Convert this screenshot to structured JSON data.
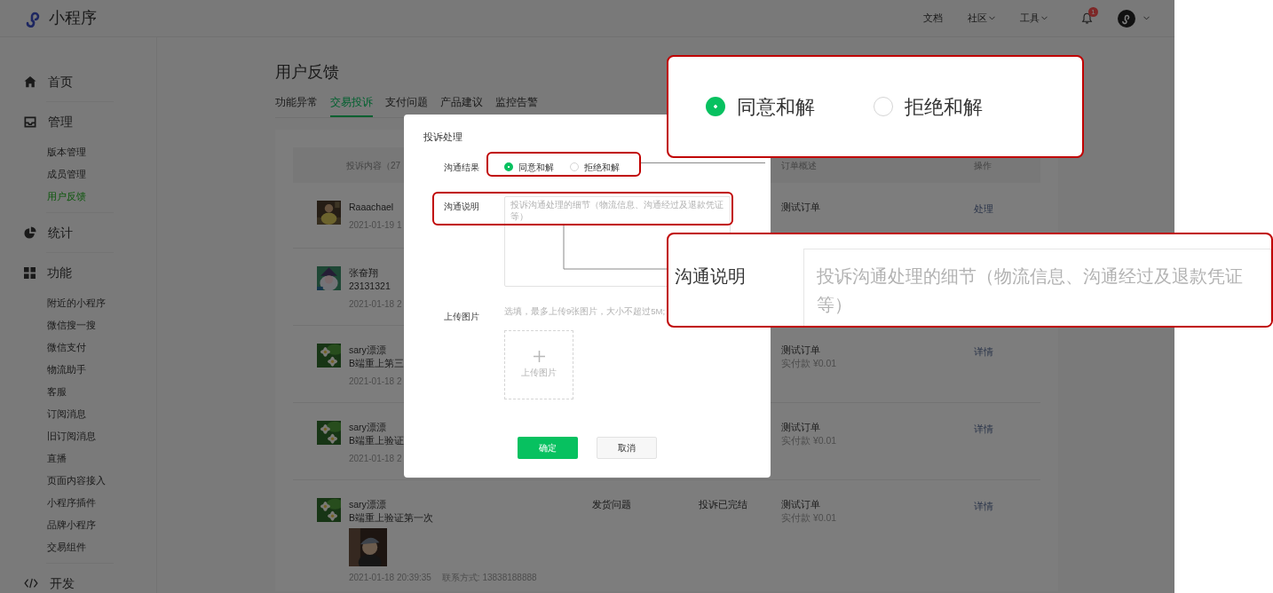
{
  "header": {
    "brand": "小程序",
    "nav": [
      {
        "label": "文档",
        "dropdown": false
      },
      {
        "label": "社区",
        "dropdown": true
      },
      {
        "label": "工具",
        "dropdown": true
      }
    ],
    "notification_count": "1"
  },
  "sidebar": [
    {
      "label": "首页"
    },
    {
      "label": "管理",
      "items": [
        {
          "label": "版本管理",
          "selected": false
        },
        {
          "label": "成员管理",
          "selected": false
        },
        {
          "label": "用户反馈",
          "selected": true
        }
      ]
    },
    {
      "label": "统计"
    },
    {
      "label": "功能",
      "items": [
        {
          "label": "附近的小程序",
          "selected": false
        },
        {
          "label": "微信搜一搜",
          "selected": false
        },
        {
          "label": "微信支付",
          "selected": false
        },
        {
          "label": "物流助手",
          "selected": false
        },
        {
          "label": "客服",
          "selected": false
        },
        {
          "label": "订阅消息",
          "selected": false
        },
        {
          "label": "旧订阅消息",
          "selected": false
        },
        {
          "label": "直播",
          "selected": false
        },
        {
          "label": "页面内容接入",
          "selected": false
        },
        {
          "label": "小程序插件",
          "selected": false
        },
        {
          "label": "品牌小程序",
          "selected": false
        },
        {
          "label": "交易组件",
          "selected": false
        }
      ]
    },
    {
      "label": "开发"
    }
  ],
  "page": {
    "title": "用户反馈",
    "tabs": [
      {
        "label": "功能异常",
        "selected": false
      },
      {
        "label": "交易投诉",
        "selected": true
      },
      {
        "label": "支付问题",
        "selected": false
      },
      {
        "label": "产品建议",
        "selected": false
      },
      {
        "label": "监控告警",
        "selected": false
      }
    ]
  },
  "table": {
    "columns": [
      {
        "label": "投诉内容（27",
        "kind": "content"
      },
      {
        "label": "订单概述",
        "kind": "order"
      },
      {
        "label": "操作",
        "kind": "action"
      }
    ],
    "rows": [
      {
        "avatar": {
          "kind": "picture"
        },
        "name": "Raaachael",
        "time": "2021-01-19 1",
        "order": "测试订单",
        "actions": [
          "处理"
        ]
      },
      {
        "avatar": {
          "kind": "picture"
        },
        "name": "张奋翔",
        "message": "23131321",
        "time": "2021-01-18 2"
      },
      {
        "avatar": {
          "kind": "picture"
        },
        "name": "sary漂漂",
        "message": "B端重上第三",
        "time": "2021-01-18 2",
        "order": "测试订单",
        "paid": "实付款 ¥0.01",
        "actions": [
          "详情"
        ]
      },
      {
        "avatar": {
          "kind": "picture"
        },
        "name": "sary漂漂",
        "message": "B端重上验证",
        "time": "2021-01-18 2",
        "order": "测试订单",
        "paid": "实付款 ¥0.01",
        "actions": [
          "详情"
        ]
      },
      {
        "avatar": {
          "kind": "picture"
        },
        "name": "sary漂漂",
        "message": "B端重上验证第一次",
        "attachment": {
          "kind": "picture"
        },
        "time": "2021-01-18 20:39:35",
        "contact": "联系方式: 13838188888",
        "issue": "发货问题",
        "status": "投诉已完结",
        "order": "测试订单",
        "paid": "实付款 ¥0.01",
        "actions": [
          "详情"
        ]
      }
    ]
  },
  "modal": {
    "title": "投诉处理",
    "result": {
      "label": "沟通结果",
      "options": [
        {
          "label": "同意和解",
          "selected": true
        },
        {
          "label": "拒绝和解",
          "selected": false
        }
      ]
    },
    "note": {
      "label": "沟通说明",
      "placeholder": "投诉沟通处理的细节（物流信息、沟通经过及退款凭证等）"
    },
    "upload": {
      "label": "上传图片",
      "hint": "选填，最多上传9张图片，大小不超过5M;",
      "tile_label": "上传图片"
    },
    "buttons": [
      {
        "label": "确定",
        "kind": "primary"
      },
      {
        "label": "取消",
        "kind": "secondary"
      }
    ]
  },
  "callouts": [
    {
      "kind": "radios",
      "options": [
        {
          "label": "同意和解",
          "selected": true
        },
        {
          "label": "拒绝和解",
          "selected": false
        }
      ]
    },
    {
      "kind": "field",
      "label": "沟通说明",
      "placeholder": "投诉沟通处理的细节（物流信息、沟通经过及退款凭证等）"
    }
  ]
}
